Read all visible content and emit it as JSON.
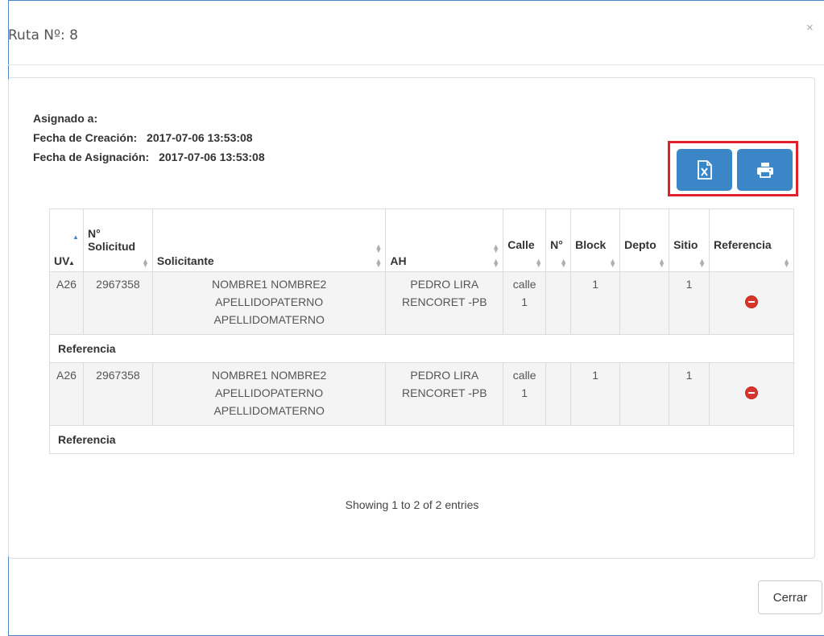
{
  "modal": {
    "title": "Ruta Nº: 8",
    "close_glyph": "×"
  },
  "info": {
    "asignado_label": "Asignado a:",
    "asignado_value": "",
    "creacion_label": "Fecha de Creación:",
    "creacion_value": "2017-07-06 13:53:08",
    "asignacion_label": "Fecha de Asignación:",
    "asignacion_value": "2017-07-06 13:53:08"
  },
  "actions": {
    "excel_icon": "file-excel-icon",
    "print_icon": "print-icon",
    "accent_color": "#3b86c6",
    "highlight_color": "#e0202a"
  },
  "table": {
    "headers": {
      "uv": "UV",
      "solicitud_line1": "N°",
      "solicitud_line2": "Solicitud",
      "solicitante": "Solicitante",
      "ah": "AH",
      "calle": "Calle",
      "numero": "N°",
      "block": "Block",
      "depto": "Depto",
      "sitio": "Sitio",
      "referencia": "Referencia"
    },
    "rows": [
      {
        "uv": "A26",
        "solicitud": "2967358",
        "solicitante": [
          "NOMBRE1 NOMBRE2",
          "APELLIDOPATERNO",
          "APELLIDOMATERNO"
        ],
        "ah": [
          "PEDRO LIRA",
          "RENCORET -PB"
        ],
        "calle": [
          "calle",
          "1"
        ],
        "numero": "",
        "block": "1",
        "depto": "",
        "sitio": "1",
        "ref_label": "Referencia"
      },
      {
        "uv": "A26",
        "solicitud": "2967358",
        "solicitante": [
          "NOMBRE1 NOMBRE2",
          "APELLIDOPATERNO",
          "APELLIDOMATERNO"
        ],
        "ah": [
          "PEDRO LIRA",
          "RENCORET -PB"
        ],
        "calle": [
          "calle",
          "1"
        ],
        "numero": "",
        "block": "1",
        "depto": "",
        "sitio": "1",
        "ref_label": "Referencia"
      }
    ]
  },
  "footer": {
    "entries": "Showing 1 to 2 of 2 entries",
    "close_label": "Cerrar"
  }
}
